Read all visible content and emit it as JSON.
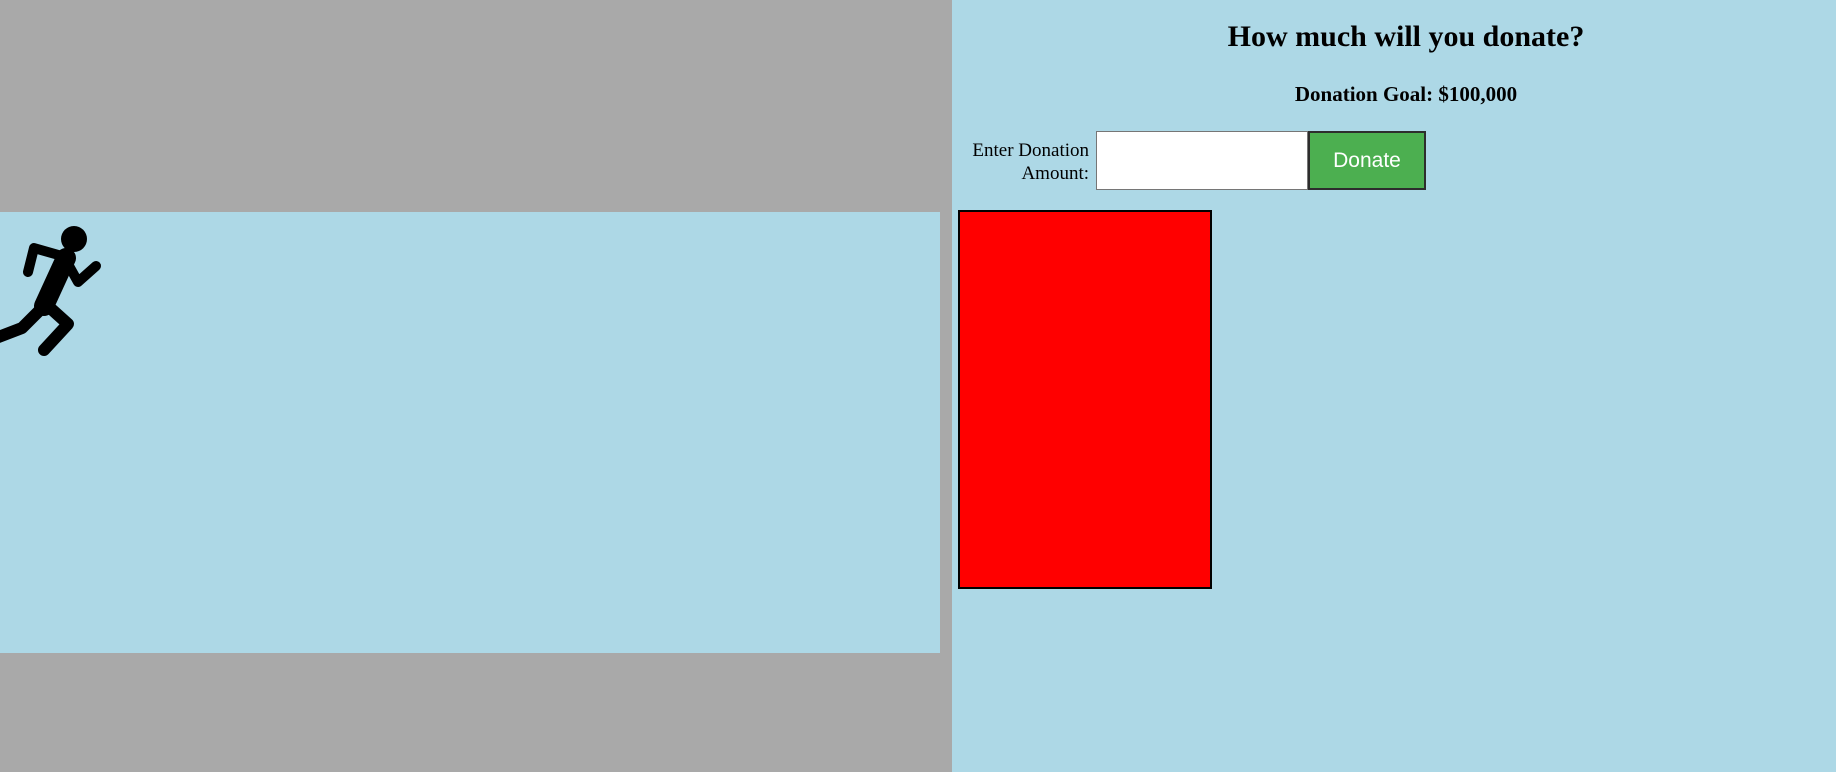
{
  "game": {
    "runner_icon": "running-person-icon"
  },
  "donation": {
    "heading": "How much will you donate?",
    "goal_text": "Donation Goal: $100,000",
    "input_label": "Enter Donation Amount:",
    "input_value": "",
    "input_placeholder": "",
    "button_label": "Donate",
    "progress_fraction": 1.0
  },
  "colors": {
    "background_gray": "#a9a9a9",
    "panel_blue": "#add8e6",
    "button_green": "#4caf50",
    "progress_red": "#ff0000"
  }
}
